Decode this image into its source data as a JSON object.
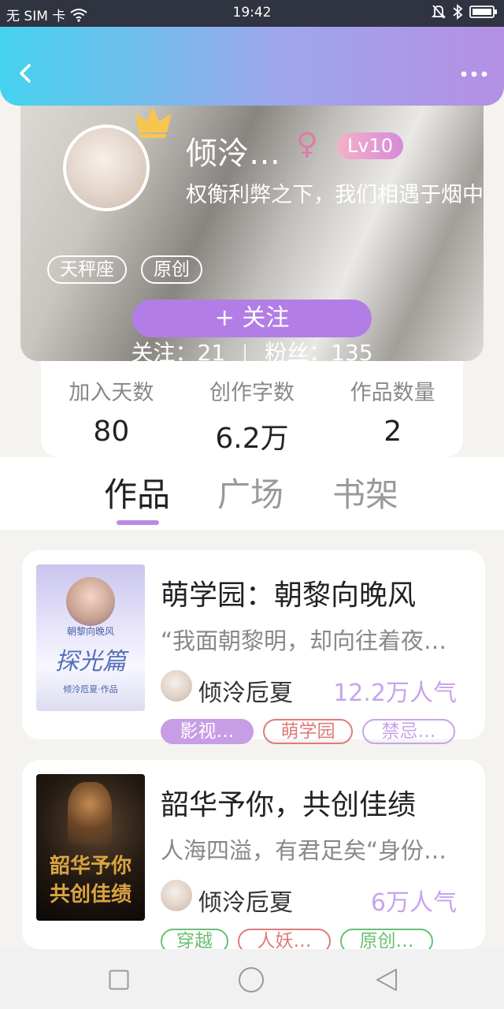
{
  "status_bar": {
    "carrier": "无 SIM 卡",
    "time": "19:42"
  },
  "profile": {
    "name": "倾泠…",
    "gender_symbol": "♀",
    "level": "Lv10",
    "bio": "权衡利弊之下，我们相遇于烟中",
    "tags": [
      "天秤座",
      "原创"
    ],
    "follow_label": "+  关注",
    "following_label": "关注：21",
    "followers_label": "粉丝：135"
  },
  "stats": [
    {
      "label": "加入天数",
      "value": "80"
    },
    {
      "label": "创作字数",
      "value": "6.2万"
    },
    {
      "label": "作品数量",
      "value": "2"
    }
  ],
  "tabs": [
    "作品",
    "广场",
    "书架"
  ],
  "books": [
    {
      "title": "萌学园：朝黎向晚风",
      "desc": "“我面朝黎明，却向往着夜…",
      "author": "倾泠卮夏",
      "popularity": "12.2万人气",
      "cover_text": [
        "朝黎向晚风",
        "探光篇",
        "倾泠卮夏·作品"
      ],
      "chips": [
        {
          "label": "影视…",
          "style": "filled",
          "color": "#c79de6"
        },
        {
          "label": "萌学园",
          "style": "outline",
          "color": "#e07b7b"
        },
        {
          "label": "禁忌…",
          "style": "outline",
          "color": "#c9a3ea"
        }
      ]
    },
    {
      "title": "韶华予你，共创佳绩",
      "desc": "人海四溢，有君足矣“身份…",
      "author": "倾泠卮夏",
      "popularity": "6万人气",
      "cover_text": [
        "韶华予你",
        "共创佳绩"
      ],
      "chips": [
        {
          "label": "穿越",
          "style": "outline",
          "color": "#6bbf75"
        },
        {
          "label": "人妖…",
          "style": "outline",
          "color": "#e07b7b"
        },
        {
          "label": "原创…",
          "style": "outline",
          "color": "#6bbf75"
        }
      ]
    }
  ]
}
